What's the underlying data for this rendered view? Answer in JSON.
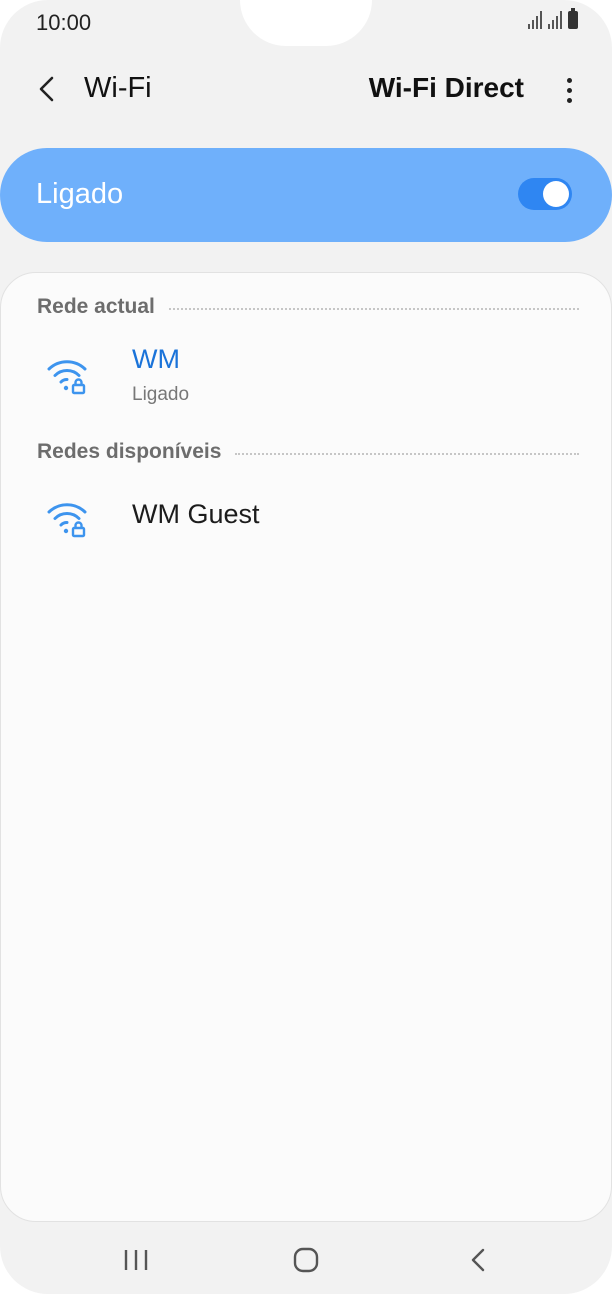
{
  "status_bar": {
    "time": "10:00",
    "icons": [
      "signal-icon",
      "signal-icon",
      "battery-icon"
    ]
  },
  "app_bar": {
    "back_icon": "chevron-left-icon",
    "title": "Wi-Fi",
    "action_label": "Wi-Fi Direct",
    "more_icon": "more-vertical-icon"
  },
  "master_switch": {
    "label": "Ligado",
    "on": true
  },
  "sections": {
    "current": {
      "title": "Rede actual"
    },
    "available": {
      "title": "Redes disponíveis"
    }
  },
  "networks": {
    "current": {
      "name": "WM",
      "status": "Ligado",
      "icon": "wifi-lock-icon"
    },
    "available": [
      {
        "name": "WM Guest",
        "icon": "wifi-lock-icon"
      }
    ]
  },
  "nav_bar": {
    "recents_icon": "recents-icon",
    "home_icon": "home-icon",
    "back_icon": "back-icon"
  },
  "colors": {
    "accent": "#2f86f2",
    "toggle_bar": "#6fb0fb",
    "connected_text": "#1a73d9",
    "wifi_icon": "#3d94ee"
  }
}
